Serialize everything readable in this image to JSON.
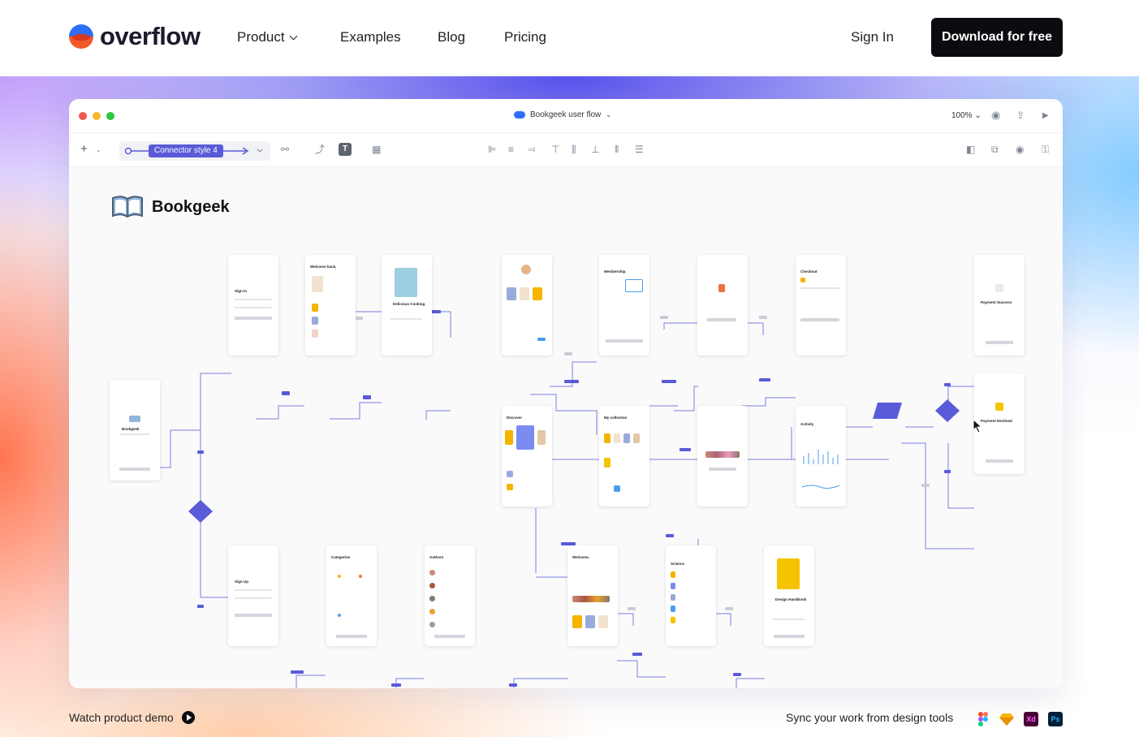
{
  "nav": {
    "logo": "overflow",
    "items": [
      {
        "label": "Product"
      },
      {
        "label": "Examples"
      },
      {
        "label": "Blog"
      },
      {
        "label": "Pricing"
      }
    ],
    "signin": "Sign In",
    "cta": "Download for free"
  },
  "app": {
    "doc_title": "Bookgeek user flow",
    "zoom": "100%",
    "connector": "Connector style 4",
    "project": "Bookgeek"
  },
  "frames": [
    {
      "title": "Bookgeek"
    },
    {
      "title": "Sign In"
    },
    {
      "title": "Welcome back,"
    },
    {
      "title": "Delicious Cooking"
    },
    {
      "title": ""
    },
    {
      "title": "Membership"
    },
    {
      "title": ""
    },
    {
      "title": "Checkout"
    },
    {
      "title": "Payment Success"
    },
    {
      "title": "Payment Declined"
    },
    {
      "title": "Discover"
    },
    {
      "title": "My collection"
    },
    {
      "title": ""
    },
    {
      "title": "Activity"
    },
    {
      "title": "Sign Up"
    },
    {
      "title": "Categories"
    },
    {
      "title": "Authors"
    },
    {
      "title": "Welcome,"
    },
    {
      "title": "Science"
    },
    {
      "title": "Design Handbook"
    }
  ],
  "footer": {
    "demo": "Watch product demo",
    "sync": "Sync your work from design tools",
    "tools": [
      "Xd",
      "Ps"
    ]
  },
  "colors": {
    "accent": "#5a5bd8",
    "cta": "#0b0b10"
  }
}
